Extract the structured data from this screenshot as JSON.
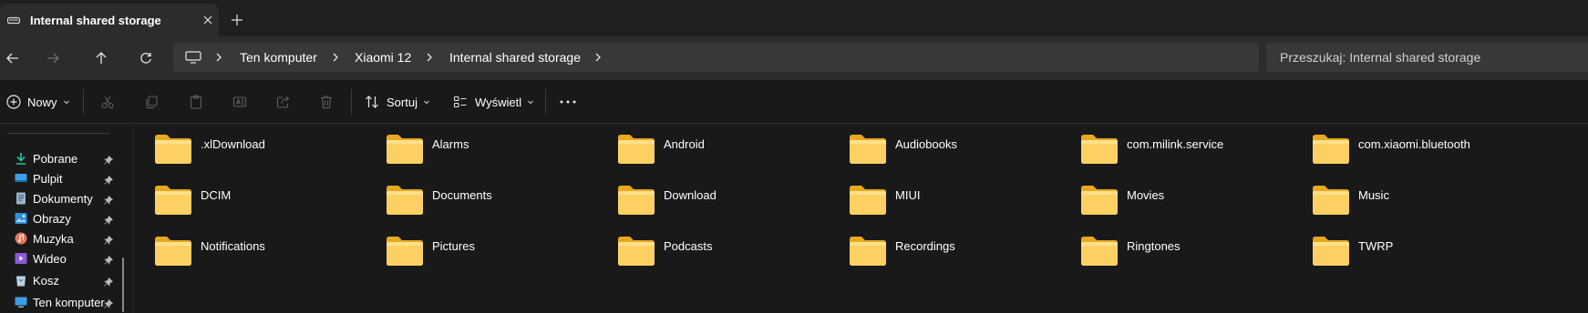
{
  "tab": {
    "title": "Internal shared storage"
  },
  "breadcrumbs": [
    "Ten komputer",
    "Xiaomi 12",
    "Internal shared storage"
  ],
  "search": {
    "placeholder": "Przeszukaj: Internal shared storage"
  },
  "commands": {
    "new": "Nowy",
    "sort": "Sortuj",
    "view": "Wyświetl"
  },
  "sidebar": {
    "items": [
      {
        "label": "Pobrane",
        "icon": "download-icon",
        "color": "#1fc9a4"
      },
      {
        "label": "Pulpit",
        "icon": "desktop-icon",
        "color": "#3aa0e6"
      },
      {
        "label": "Dokumenty",
        "icon": "document-icon",
        "color": "#9bb1c9"
      },
      {
        "label": "Obrazy",
        "icon": "image-icon",
        "color": "#2f8ed8"
      },
      {
        "label": "Muzyka",
        "icon": "music-icon",
        "color": "#e0785e"
      },
      {
        "label": "Wideo",
        "icon": "video-icon",
        "color": "#8a5ad9"
      },
      {
        "label": "Kosz",
        "icon": "recycle-bin-icon",
        "color": "#bfd2e0"
      },
      {
        "label": "Ten komputer",
        "icon": "computer-icon",
        "color": "#3aa0e6"
      }
    ]
  },
  "folders": [
    ".xlDownload",
    "Alarms",
    "Android",
    "Audiobooks",
    "com.milink.service",
    "com.xiaomi.bluetooth",
    "DCIM",
    "Documents",
    "Download",
    "MIUI",
    "Movies",
    "Music",
    "Notifications",
    "Pictures",
    "Podcasts",
    "Recordings",
    "Ringtones",
    "TWRP"
  ],
  "colors": {
    "folder": "#f8c84a",
    "folder_back": "#e8a820",
    "accent": "#4cc2ff"
  }
}
